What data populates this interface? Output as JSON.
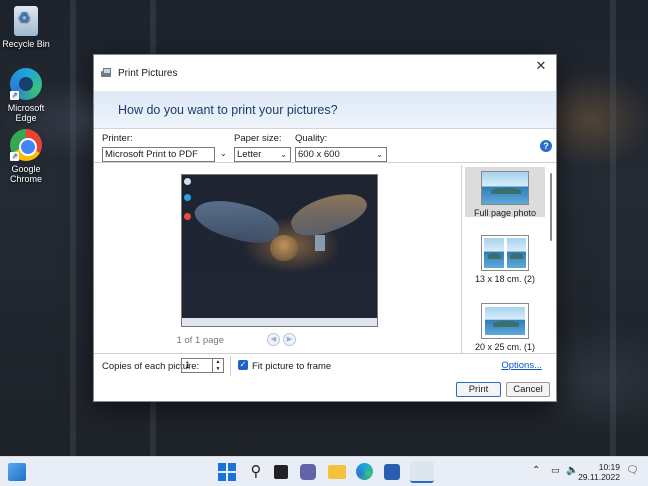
{
  "desktop": {
    "icons": [
      {
        "label": "Recycle Bin"
      },
      {
        "label": "Microsoft Edge"
      },
      {
        "label": "Google Chrome"
      }
    ]
  },
  "dialog": {
    "title": "Print Pictures",
    "close_glyph": "✕",
    "heading": "How do you want to print your pictures?",
    "printer": {
      "label": "Printer:",
      "value": "Microsoft Print to PDF"
    },
    "paper_size": {
      "label": "Paper size:",
      "value": "Letter"
    },
    "quality": {
      "label": "Quality:",
      "value": "600 x 600"
    },
    "help_glyph": "?",
    "page_count": "1 of 1 page",
    "layouts": [
      {
        "label": "Full page photo",
        "selected": true
      },
      {
        "label": "13 x 18 cm. (2)",
        "selected": false
      },
      {
        "label": "20 x 25 cm. (1)",
        "selected": false
      }
    ],
    "copies": {
      "label": "Copies of each picture:",
      "value": "1"
    },
    "fit_picture": {
      "label": "Fit picture to frame",
      "checked": true
    },
    "options_link": "Options...",
    "print_button": "Print",
    "cancel_button": "Cancel"
  },
  "taskbar": {
    "time": "10:19",
    "date": "29.11.2022",
    "chevron_glyph": "⌃"
  }
}
